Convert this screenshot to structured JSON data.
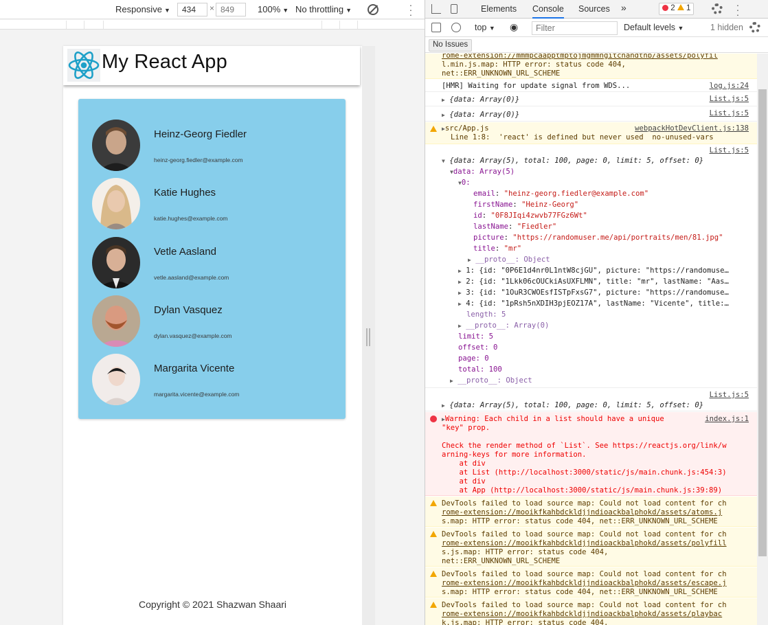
{
  "device_toolbar": {
    "device": "Responsive",
    "width": "434",
    "height": "849",
    "times": "×",
    "zoom": "100%",
    "throttle": "No throttling"
  },
  "app": {
    "title": "My React App",
    "users": [
      {
        "name": "Heinz-Georg Fiedler",
        "email": "heinz-georg.fiedler@example.com",
        "skin": "#c9a58a",
        "bg": "#3b3b3b"
      },
      {
        "name": "Katie Hughes",
        "email": "katie.hughes@example.com",
        "skin": "#e9c9ae",
        "bg": "#d9b98a"
      },
      {
        "name": "Vetle Aasland",
        "email": "vetle.aasland@example.com",
        "skin": "#d8b096",
        "bg": "#2b2b2b"
      },
      {
        "name": "Dylan Vasquez",
        "email": "dylan.vasquez@example.com",
        "skin": "#d99a80",
        "bg": "#b9a892"
      },
      {
        "name": "Margarita Vicente",
        "email": "margarita.vicente@example.com",
        "skin": "#efd8cc",
        "bg": "#f1ecea"
      }
    ],
    "copyright": "Copyright © 2021 Shazwan Shaari"
  },
  "devtools": {
    "tabs": [
      "Elements",
      "Console",
      "Sources"
    ],
    "more": "»",
    "errors": "2",
    "warnings": "1",
    "context": "top",
    "filter_placeholder": "Filter",
    "levels": "Default levels",
    "hidden": "1 hidden",
    "issues": "No Issues",
    "colors": {
      "accent": "#1a73e8",
      "error": "#e34",
      "warning": "#f2a600"
    }
  },
  "console": {
    "top_warn": {
      "l1": "rome-extension://mmmpcaapptmptojmgmmngitchandthb/assets/polyfil",
      "l2": "l.min.js.map: HTTP error: status code 404,",
      "l3": "net::ERR_UNKNOWN_URL_SCHEME"
    },
    "hmr": {
      "text": "[HMR] Waiting for update signal from WDS...",
      "src": "log.js:24"
    },
    "obj0a": {
      "text": "{data: Array(0)}",
      "src": "List.js:5"
    },
    "obj0b": {
      "text": "{data: Array(0)}",
      "src": "List.js:5"
    },
    "app_warn": {
      "text": "src/App.js",
      "src": "webpackHotDevClient.js:138",
      "detail": "Line 1:8:  'react' is defined but never used  no-unused-vars"
    },
    "expanded": {
      "src": "List.js:5",
      "summary": "{data: Array(5), total: 100, page: 0, limit: 5, offset: 0}",
      "data_label": "data: Array(5)",
      "index0": "0:",
      "fields": [
        {
          "k": "email",
          "v": "\"heinz-georg.fiedler@example.com\""
        },
        {
          "k": "firstName",
          "v": "\"Heinz-Georg\""
        },
        {
          "k": "id",
          "v": "\"0F8JIqi4zwvb77FGz6Wt\""
        },
        {
          "k": "lastName",
          "v": "\"Fiedler\""
        },
        {
          "k": "picture",
          "v": "\"https://randomuser.me/api/portraits/men/81.jpg\""
        },
        {
          "k": "title",
          "v": "\"mr\""
        }
      ],
      "proto_obj": "__proto__: Object",
      "rows": [
        "1: {id: \"0P6E1d4nr0L1ntW8cjGU\", picture: \"https://randomuse…",
        "2: {id: \"1Lkk06cOUCkiAsUXFLMN\", title: \"mr\", lastName: \"Aas…",
        "3: {id: \"1OuR3CWOEsfISTpFxsG7\", picture: \"https://randomuse…",
        "4: {id: \"1pRsh5nXDIH3pjEOZ17A\", lastName: \"Vicente\", title:…"
      ],
      "length": "length: 5",
      "proto_arr": "__proto__: Array(0)",
      "limit": "limit: 5",
      "offset": "offset: 0",
      "page": "page: 0",
      "total": "total: 100",
      "proto_outer": "__proto__: Object"
    },
    "obj5": {
      "text": "{data: Array(5), total: 100, page: 0, limit: 5, offset: 0}",
      "src": "List.js:5"
    },
    "error": {
      "src": "index.js:1",
      "l1": "Warning: Each child in a list should have a unique",
      "l2": "\"key\" prop.",
      "l3": "Check the render method of `List`. See https://reactjs.org/link/w",
      "l4": "arning-keys for more information.",
      "l5": "    at div",
      "l6": "    at List (http://localhost:3000/static/js/main.chunk.js:454:3)",
      "l7": "    at div",
      "l8": "    at App (http://localhost:3000/static/js/main.chunk.js:39:89)"
    },
    "w1": {
      "l1": "DevTools failed to load source map: Could not load content for ch",
      "l2": "rome-extension://mooikfkahbdckldjjndioackbalphokd/assets/atoms.j",
      "l3": "s.map: HTTP error: status code 404, net::ERR_UNKNOWN_URL_SCHEME"
    },
    "w2": {
      "l1": "DevTools failed to load source map: Could not load content for ch",
      "l2": "rome-extension://mooikfkahbdckldjjndioackbalphokd/assets/polyfill",
      "l3": "s.js.map: HTTP error: status code 404,",
      "l4": "net::ERR_UNKNOWN_URL_SCHEME"
    },
    "w3": {
      "l1": "DevTools failed to load source map: Could not load content for ch",
      "l2": "rome-extension://mooikfkahbdckldjjndioackbalphokd/assets/escape.j",
      "l3": "s.map: HTTP error: status code 404, net::ERR_UNKNOWN_URL_SCHEME"
    },
    "w4": {
      "l1": "DevTools failed to load source map: Could not load content for ch",
      "l2": "rome-extension://mooikfkahbdckldjjndioackbalphokd/assets/playbac",
      "l3": "k.js.map: HTTP error: status code 404,"
    }
  }
}
